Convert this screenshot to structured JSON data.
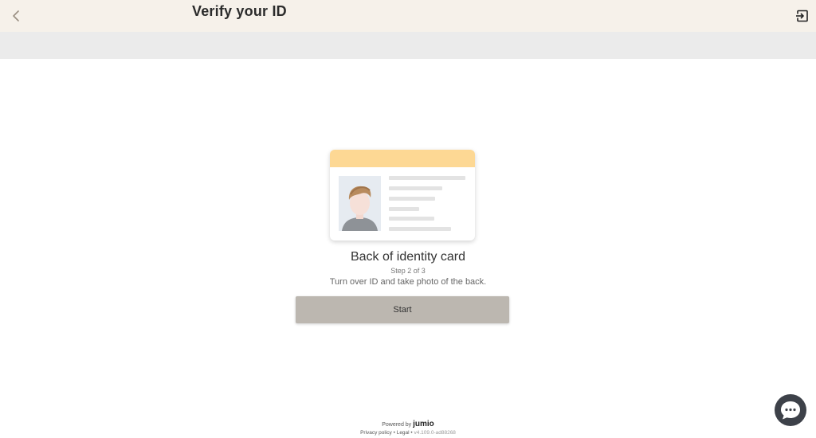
{
  "header": {
    "title": "Verify your ID",
    "back_icon": "chevron-left-icon",
    "exit_icon": "exit-icon",
    "background": "#f6f1ea"
  },
  "main": {
    "document_title": "Back of identity card",
    "step_text": "Step 2 of 3",
    "instruction": "Turn over ID and take photo of the back.",
    "start_label": "Start",
    "card_accent": "#fdd894",
    "button_color": "#bcb7b0"
  },
  "footer": {
    "powered_by": "Powered by",
    "brand": "jumio",
    "privacy_label": "Privacy policy",
    "separator": "•",
    "legal_label": "Legal",
    "version": "v4.109.0-ad88268"
  },
  "chat": {
    "icon": "chat-bubble-icon"
  }
}
